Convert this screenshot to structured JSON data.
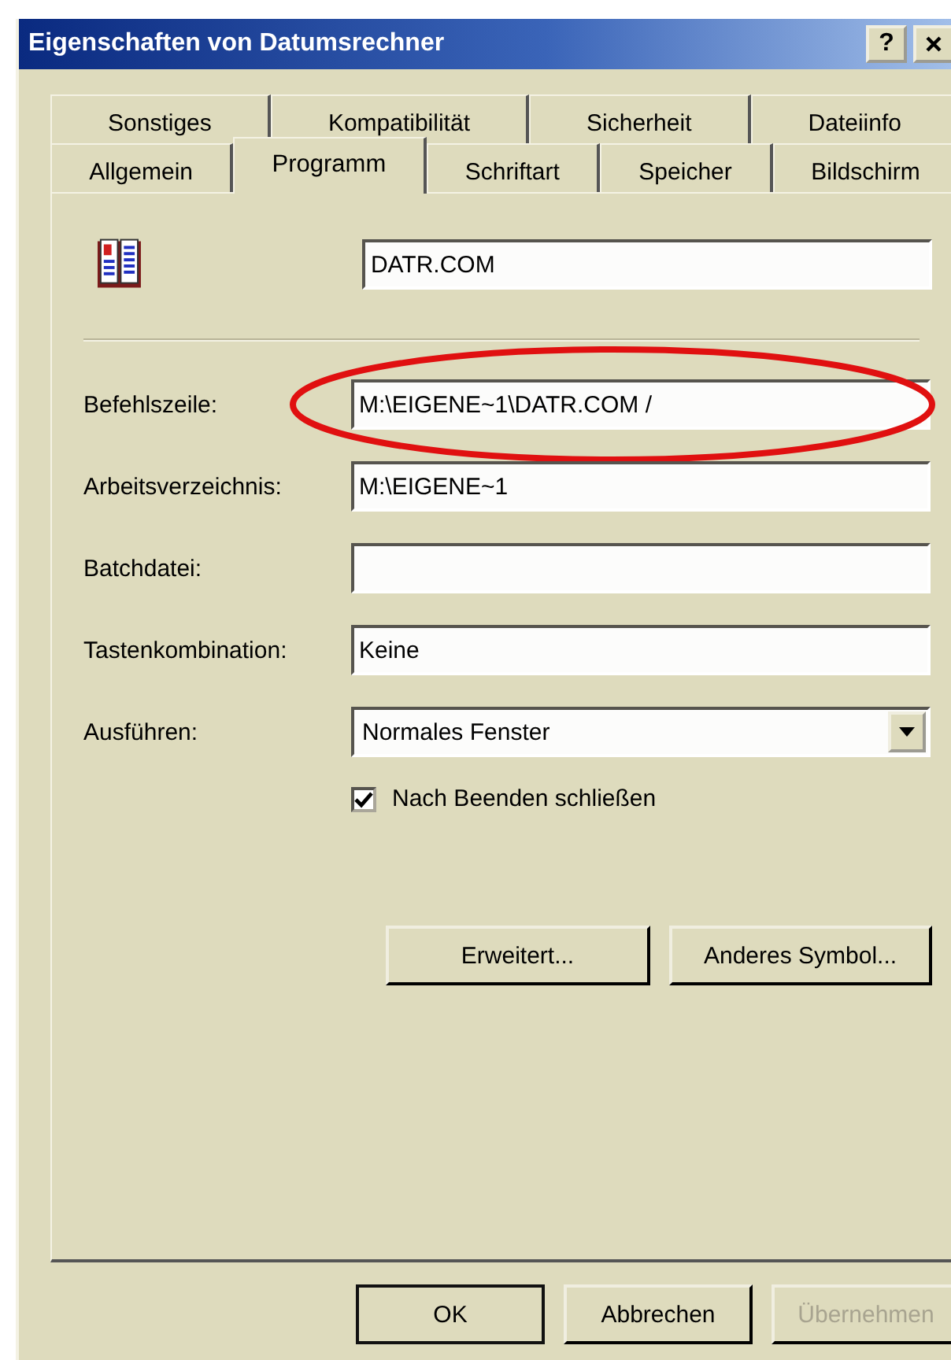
{
  "window": {
    "title": "Eigenschaften von Datumsrechner",
    "help": "?"
  },
  "tabs_back": [
    {
      "label": "Sonstiges",
      "selected": false
    },
    {
      "label": "Kompatibilität",
      "selected": false
    },
    {
      "label": "Sicherheit",
      "selected": false
    },
    {
      "label": "Dateiinfo",
      "selected": false
    }
  ],
  "tabs_front": [
    {
      "label": "Allgemein",
      "selected": false
    },
    {
      "label": "Programm",
      "selected": true
    },
    {
      "label": "Schriftart",
      "selected": false
    },
    {
      "label": "Speicher",
      "selected": false
    },
    {
      "label": "Bildschirm",
      "selected": false
    }
  ],
  "name_field": {
    "value": "DATR.COM"
  },
  "fields": [
    {
      "kind": "text",
      "label": "Befehlszeile:",
      "value": "M:\\EIGENE~1\\DATR.COM /",
      "highlighted": true
    },
    {
      "kind": "text",
      "label": "Arbeitsverzeichnis:",
      "value": "M:\\EIGENE~1",
      "highlighted": false
    },
    {
      "kind": "text",
      "label": "Batchdatei:",
      "highlighted": false
    },
    {
      "kind": "text",
      "label": "Tastenkombination:",
      "value": "Keine",
      "highlighted": false
    },
    {
      "kind": "dropdown",
      "label": "Ausführen:",
      "value": "Normales Fenster",
      "highlighted": false
    }
  ],
  "checkbox": {
    "label": "Nach Beenden schließen",
    "checked": true
  },
  "panel_buttons": [
    {
      "label": "Erweitert..."
    },
    {
      "label": "Anderes Symbol..."
    }
  ],
  "dialog_buttons": [
    {
      "label": "OK",
      "default": true,
      "disabled": false
    },
    {
      "label": "Abbrechen",
      "default": false,
      "disabled": false
    },
    {
      "label": "Übernehmen",
      "default": false,
      "disabled": true
    }
  ]
}
